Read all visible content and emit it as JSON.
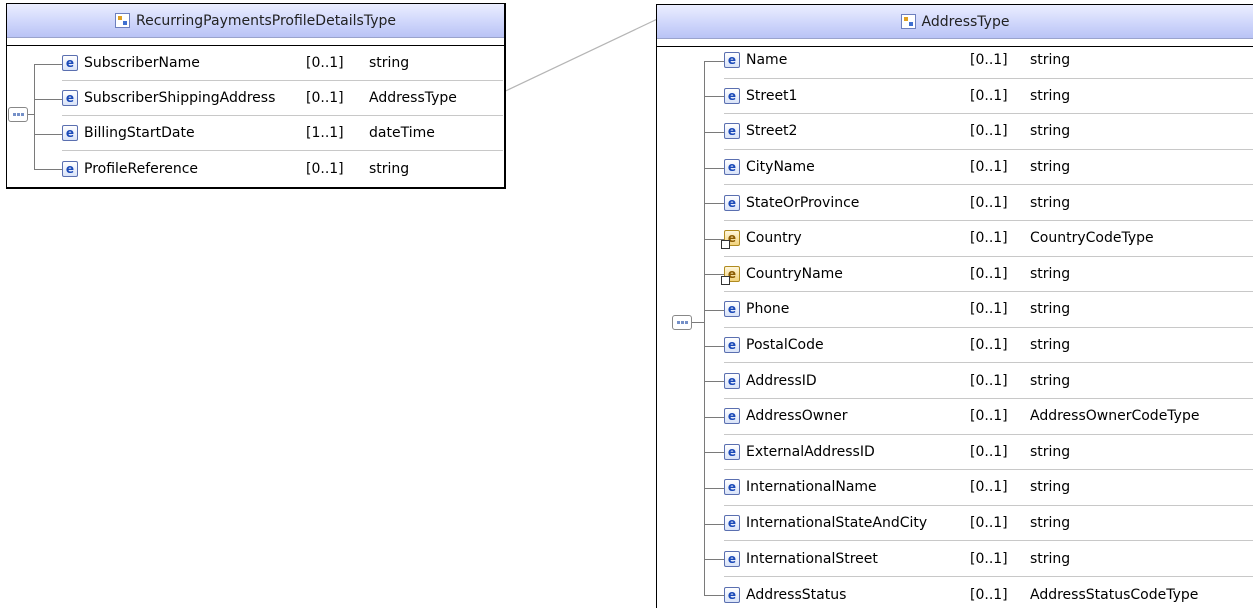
{
  "left_type": {
    "title": "RecurringPaymentsProfileDetailsType",
    "elements": [
      {
        "name": "SubscriberName",
        "multiplicity": "[0..1]",
        "type": "string",
        "ref": false
      },
      {
        "name": "SubscriberShippingAddress",
        "multiplicity": "[0..1]",
        "type": "AddressType",
        "ref": false
      },
      {
        "name": "BillingStartDate",
        "multiplicity": "[1..1]",
        "type": "dateTime",
        "ref": false
      },
      {
        "name": "ProfileReference",
        "multiplicity": "[0..1]",
        "type": "string",
        "ref": false
      }
    ]
  },
  "right_type": {
    "title": "AddressType",
    "elements": [
      {
        "name": "Name",
        "multiplicity": "[0..1]",
        "type": "string",
        "ref": false
      },
      {
        "name": "Street1",
        "multiplicity": "[0..1]",
        "type": "string",
        "ref": false
      },
      {
        "name": "Street2",
        "multiplicity": "[0..1]",
        "type": "string",
        "ref": false
      },
      {
        "name": "CityName",
        "multiplicity": "[0..1]",
        "type": "string",
        "ref": false
      },
      {
        "name": "StateOrProvince",
        "multiplicity": "[0..1]",
        "type": "string",
        "ref": false
      },
      {
        "name": "Country",
        "multiplicity": "[0..1]",
        "type": "CountryCodeType",
        "ref": true
      },
      {
        "name": "CountryName",
        "multiplicity": "[0..1]",
        "type": "string",
        "ref": true
      },
      {
        "name": "Phone",
        "multiplicity": "[0..1]",
        "type": "string",
        "ref": false
      },
      {
        "name": "PostalCode",
        "multiplicity": "[0..1]",
        "type": "string",
        "ref": false
      },
      {
        "name": "AddressID",
        "multiplicity": "[0..1]",
        "type": "string",
        "ref": false
      },
      {
        "name": "AddressOwner",
        "multiplicity": "[0..1]",
        "type": "AddressOwnerCodeType",
        "ref": false
      },
      {
        "name": "ExternalAddressID",
        "multiplicity": "[0..1]",
        "type": "string",
        "ref": false
      },
      {
        "name": "InternationalName",
        "multiplicity": "[0..1]",
        "type": "string",
        "ref": false
      },
      {
        "name": "InternationalStateAndCity",
        "multiplicity": "[0..1]",
        "type": "string",
        "ref": false
      },
      {
        "name": "InternationalStreet",
        "multiplicity": "[0..1]",
        "type": "string",
        "ref": false
      },
      {
        "name": "AddressStatus",
        "multiplicity": "[0..1]",
        "type": "AddressStatusCodeType",
        "ref": false
      }
    ]
  },
  "element_icon_letter": "e"
}
